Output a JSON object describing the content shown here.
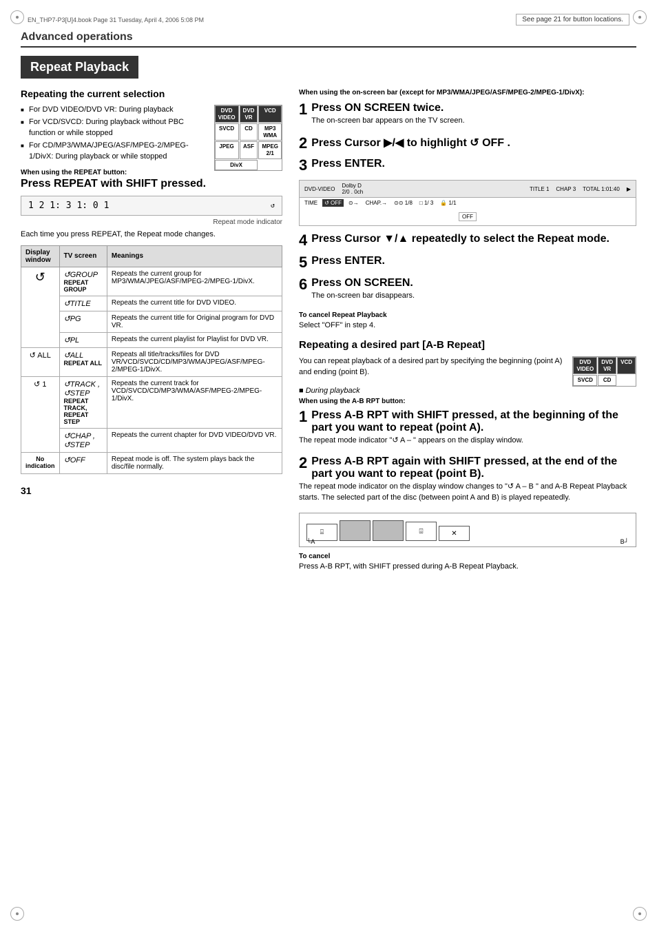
{
  "page": {
    "number": "31",
    "top_bar_left": "EN_THP7-P3[U]4.book  Page 31  Tuesday, April 4, 2006  5:08 PM",
    "top_bar_right": "See page 21 for button locations.",
    "section_heading": "Advanced operations",
    "title": "Repeat Playback",
    "subsection1": "Repeating the current selection",
    "bullets": [
      "For DVD VIDEO/DVD VR: During playback",
      "For VCD/SVCD: During playback without PBC function or while stopped",
      "For CD/MP3/WMA/JPEG/ASF/MPEG-2/MPEG-1/DivX: During playback or while stopped"
    ],
    "when_using_repeat_label": "When using the REPEAT button:",
    "press_repeat_text": "Press REPEAT with SHIFT pressed.",
    "display_indicator": "1  2    1: 3  1: 0  1",
    "repeat_indicator_label": "Repeat mode indicator",
    "each_time_text": "Each time you press REPEAT, the Repeat mode changes.",
    "table": {
      "headers": [
        "Display window",
        "TV screen",
        "Meanings"
      ],
      "rows": [
        {
          "display": "↺",
          "tv_top": "↺GROUP",
          "tv_main": "REPEAT GROUP",
          "meaning": "Repeats the current group for MP3/WMA/JPEG/ASF/MPEG-2/MPEG-1/DivX."
        },
        {
          "display": "",
          "tv_top": "↺TITLE",
          "tv_main": "",
          "meaning": "Repeats the current title for DVD VIDEO."
        },
        {
          "display": "",
          "tv_top": "↺PG",
          "tv_main": "",
          "meaning": "Repeats the current title for Original program for DVD VR."
        },
        {
          "display": "",
          "tv_top": "↺PL",
          "tv_main": "",
          "meaning": "Repeats the current playlist for Playlist for DVD VR."
        },
        {
          "display": "↺ ALL",
          "tv_top": "↺ALL",
          "tv_main": "REPEAT ALL",
          "meaning": "Repeats all title/tracks/files for DVD VR/VCD/SVCD/CD/MP3/WMA/JPEG/ASF/MPEG-2/MPEG-1/DivX."
        },
        {
          "display": "↺ 1",
          "tv_top": "↺TRACK , ↺STEP",
          "tv_main": "REPEAT TRACK, REPEAT STEP",
          "meaning": "Repeats the current track for VCD/SVCD/CD/MP3/WMA/ASF/MPEG-2/MPEG-1/DivX."
        },
        {
          "display": "",
          "tv_top": "↺CHAP , ↺STEP",
          "tv_main": "",
          "meaning": "Repeats the current chapter for DVD VIDEO/DVD VR."
        },
        {
          "display": "No indication",
          "tv_top": "↺OFF",
          "tv_main": "",
          "meaning": "Repeat mode is off. The system plays back the disc/file normally."
        }
      ]
    },
    "right_col": {
      "when_using_label": "When using the on-screen bar (except for MP3/WMA/JPEG/ASF/MPEG-2/MPEG-1/DivX):",
      "steps": [
        {
          "num": "1",
          "title": "Press ON SCREEN twice.",
          "desc": "The on-screen bar appears on the TV screen."
        },
        {
          "num": "2",
          "title": "Press Cursor ▶/◀ to highlight  ↺ OFF .",
          "desc": ""
        },
        {
          "num": "3",
          "title": "Press ENTER.",
          "desc": ""
        },
        {
          "num": "4",
          "title": "Press Cursor ▼/▲  repeatedly to select the Repeat mode.",
          "desc": ""
        },
        {
          "num": "5",
          "title": "Press ENTER.",
          "desc": ""
        },
        {
          "num": "6",
          "title": "Press ON SCREEN.",
          "desc": "The on-screen bar disappears."
        }
      ],
      "onscreen_bar": {
        "top_items": [
          "DVD-VIDEO",
          "Dolby D 2/0 . 0ch",
          "TITLE 1",
          "CHAP 3",
          "TOTAL 1:01:40",
          "▶"
        ],
        "bottom_items": [
          "TIME",
          "↺ OFF",
          "⊙→",
          "CHAP.→",
          "⊙⊙ 1/8",
          "□ 1/",
          "3",
          "🔒 1/1"
        ],
        "off_button": "OFF"
      },
      "to_cancel_repeat_label": "To cancel Repeat Playback",
      "to_cancel_repeat_desc": "Select \"OFF\" in step 4.",
      "ab_section_title": "Repeating a desired part [A-B Repeat]",
      "ab_desc_1": "You can repeat playback of a desired part by specifying the beginning (point A) and ending (point B).",
      "during_playback": "■ During playback",
      "when_using_ab_label": "When using the A-B RPT button:",
      "ab_steps": [
        {
          "num": "1",
          "title": "Press A-B RPT with SHIFT pressed, at the beginning of the part you want to repeat (point A).",
          "desc": "The repeat mode indicator \"↺  A – \" appears on the display window."
        },
        {
          "num": "2",
          "title": "Press A-B RPT again with SHIFT pressed, at the end of the part you want to repeat (point B).",
          "desc": "The repeat mode indicator on the display window changes to \"↺  A  –  B \" and A-B Repeat Playback starts. The selected part of the disc (between point A and B) is played repeatedly."
        }
      ],
      "to_cancel_ab_label": "To cancel",
      "to_cancel_ab_desc": "Press A-B RPT, with SHIFT pressed during A-B Repeat Playback."
    }
  }
}
